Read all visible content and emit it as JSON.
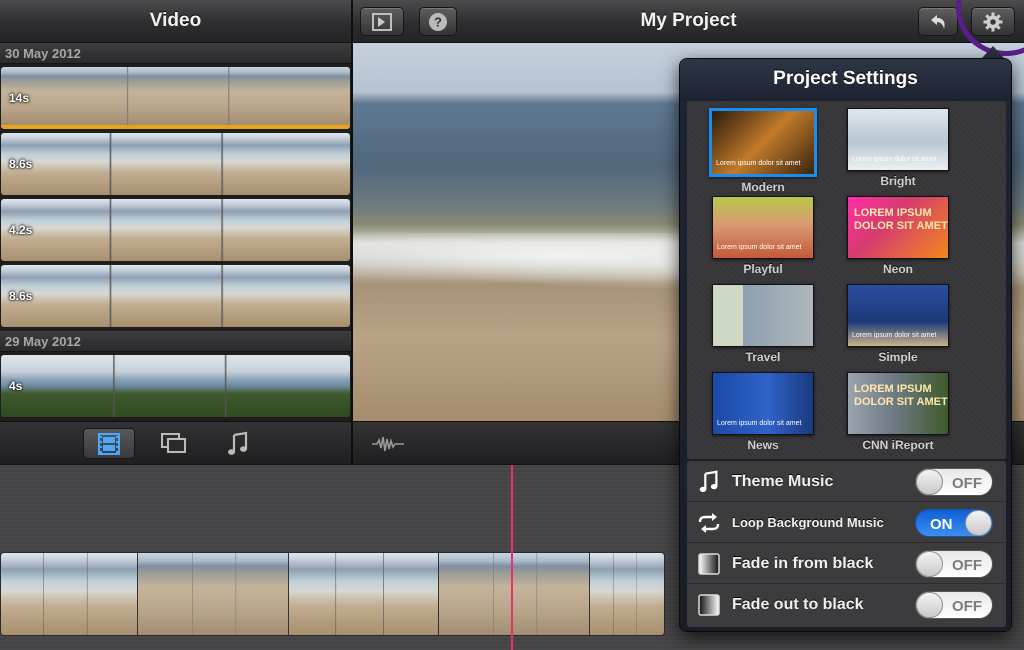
{
  "library": {
    "title": "Video",
    "sections": [
      {
        "date": "30 May 2012",
        "clips": [
          {
            "duration": "14s",
            "style": "beach-clip",
            "selected": true
          },
          {
            "duration": "8.6s",
            "style": "beach-clip",
            "selected": false
          },
          {
            "duration": "4.2s",
            "style": "beach-clip",
            "selected": false
          },
          {
            "duration": "8.6s",
            "style": "beach-clip",
            "selected": false
          }
        ]
      },
      {
        "date": "29 May 2012",
        "clips": [
          {
            "duration": "4s",
            "style": "green-clip",
            "selected": false
          }
        ]
      }
    ]
  },
  "project": {
    "title": "My Project"
  },
  "popover": {
    "title": "Project Settings",
    "themes": [
      {
        "name": "Modern",
        "selected": true,
        "bg": "linear-gradient(135deg,#2a1a0c,#c27a2a 50%,#3a2410)",
        "caption": "Lorem ipsum dolor sit amet"
      },
      {
        "name": "Bright",
        "selected": false,
        "bg": "linear-gradient(#dfe6ec,#b8c6d2 55%,#eef1f3)",
        "caption": "Lorem ipsum dolor sit amet"
      },
      {
        "name": "Playful",
        "selected": false,
        "bg": "linear-gradient(#b8c84a,#d99a74 45%,#c25a3a)",
        "caption": "Lorem ipsum dolor sit amet"
      },
      {
        "name": "Neon",
        "selected": false,
        "bg": "linear-gradient(135deg,#ff2fa8,#d63b6f 40%,#f08a1a)",
        "caption": "LOREM IPSUM DOLOR SIT AMET"
      },
      {
        "name": "Travel",
        "selected": false,
        "bg": "linear-gradient(90deg,#cfd8c4 30%,#8da0b0 30%,#aeb7ba)",
        "caption": ""
      },
      {
        "name": "Simple",
        "selected": false,
        "bg": "linear-gradient(#2a4fa0,#1c3878 60%,#c9b48a)",
        "caption": "Lorem ipsum dolor sit amet"
      },
      {
        "name": "News",
        "selected": false,
        "bg": "linear-gradient(90deg,#1b4aa8,#2f63c8 55%,#1a3a80)",
        "caption": "Lorem ipsum dolor sit amet"
      },
      {
        "name": "CNN iReport",
        "selected": false,
        "bg": "linear-gradient(90deg,#9aa4ae,#707a86 45%,#3e5a2c)",
        "caption": "LOREM IPSUM DOLOR SIT AMET"
      }
    ],
    "settings": [
      {
        "label": "Theme Music",
        "icon": "music-note-icon",
        "on": false,
        "state": "OFF"
      },
      {
        "label": "Loop Background Music",
        "icon": "loop-icon",
        "on": true,
        "state": "ON"
      },
      {
        "label": "Fade in from black",
        "icon": "fade-square-icon",
        "on": false,
        "state": "OFF"
      },
      {
        "label": "Fade out to black",
        "icon": "fade-square-icon",
        "on": false,
        "state": "OFF"
      }
    ]
  },
  "colors": {
    "accent": "#1a8df0",
    "selection": "#e8a31b",
    "playhead": "#ea2f6b",
    "highlight": "#5a1e8c"
  }
}
